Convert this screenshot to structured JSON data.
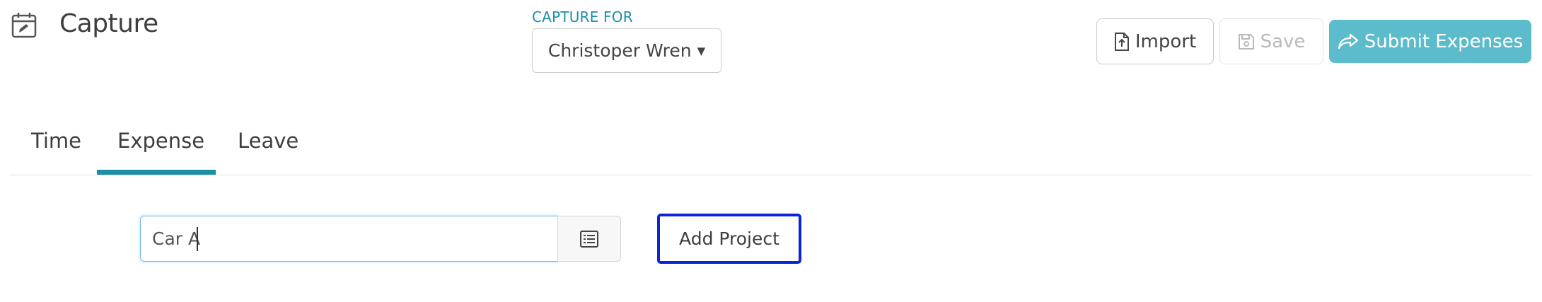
{
  "header": {
    "title": "Capture",
    "icon": "calendar-edit-icon"
  },
  "capture_for": {
    "label": "CAPTURE FOR",
    "selected": "Christoper Wren"
  },
  "toolbar": {
    "import_label": "Import",
    "save_label": "Save",
    "submit_label": "Submit Expenses"
  },
  "tabs": [
    {
      "label": "Time",
      "active": false
    },
    {
      "label": "Expense",
      "active": true
    },
    {
      "label": "Leave",
      "active": false
    }
  ],
  "search": {
    "value": "Car A",
    "placeholder": ""
  },
  "add_project_label": "Add Project",
  "colors": {
    "accent": "#1a8fa6",
    "submit_bg": "#5cbccc",
    "focus_border": "#0a24d8"
  }
}
